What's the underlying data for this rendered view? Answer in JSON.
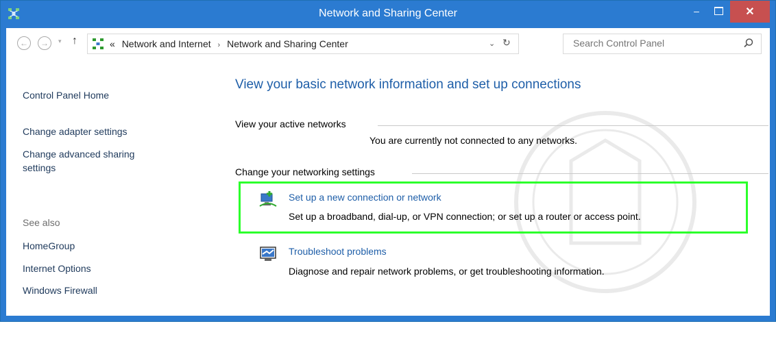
{
  "window": {
    "title": "Network and Sharing Center",
    "minimize": "–",
    "close": "✕"
  },
  "nav": {
    "back": "←",
    "forward": "→",
    "dropdown": "▾",
    "up": "↑"
  },
  "address": {
    "overflow": "«",
    "crumbs": [
      "Network and Internet",
      "Network and Sharing Center"
    ],
    "separator": "›",
    "dropdown": "⌄",
    "refresh": "↻"
  },
  "search": {
    "placeholder": "Search Control Panel"
  },
  "sidebar": {
    "home": "Control Panel Home",
    "links": [
      "Change adapter settings",
      "Change advanced sharing",
      "settings"
    ],
    "see_also": "See also",
    "see_also_links": [
      "HomeGroup",
      "Internet Options",
      "Windows Firewall"
    ]
  },
  "main": {
    "heading": "View your basic network information and set up connections",
    "active_networks_label": "View your active networks",
    "not_connected": "You are currently not connected to any networks.",
    "change_settings_label": "Change your networking settings",
    "tasks": [
      {
        "link": "Set up a new connection or network",
        "desc": "Set up a broadband, dial-up, or VPN connection; or set up a router or access point.",
        "icon": "new-connection-icon"
      },
      {
        "link": "Troubleshoot problems",
        "desc": "Diagnose and repair network problems, or get troubleshooting information.",
        "icon": "troubleshoot-icon"
      }
    ],
    "highlight_color": "#2bff2b"
  },
  "colors": {
    "titlebar": "#2b7bd1",
    "link": "#1e5ea8",
    "close": "#c75050"
  }
}
